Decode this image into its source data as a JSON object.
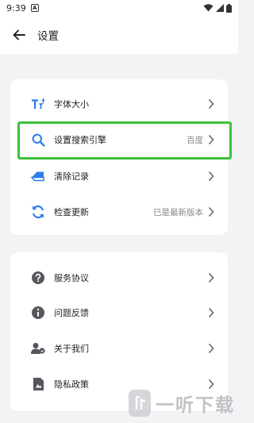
{
  "status_bar": {
    "time": "9:39",
    "badge": "A",
    "icons": [
      "wifi-icon",
      "signal-icon",
      "battery-icon"
    ]
  },
  "app_bar": {
    "title": "设置",
    "back_icon": "arrow-left-icon"
  },
  "section1": {
    "items": [
      {
        "label": "字体大小",
        "icon": "font-size-icon",
        "value": ""
      },
      {
        "label": "设置搜索引擎",
        "icon": "search-icon",
        "value": "百度"
      },
      {
        "label": "清除记录",
        "icon": "eraser-icon",
        "value": ""
      },
      {
        "label": "检查更新",
        "icon": "refresh-icon",
        "value": "已是最新版本"
      }
    ]
  },
  "section2": {
    "items": [
      {
        "label": "服务协议",
        "icon": "help-circle-icon"
      },
      {
        "label": "问题反馈",
        "icon": "info-circle-icon"
      },
      {
        "label": "关于我们",
        "icon": "about-us-icon"
      },
      {
        "label": "隐私政策",
        "icon": "privacy-document-icon"
      }
    ]
  },
  "watermark": {
    "text": "一听下载"
  },
  "colors": {
    "accent": "#2b7de9",
    "highlight": "#3cc13b",
    "background": "#f2f3f5"
  }
}
